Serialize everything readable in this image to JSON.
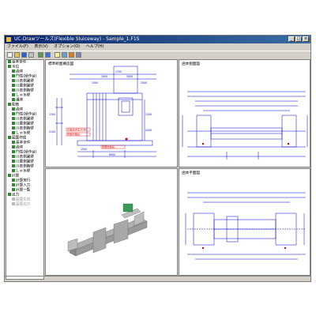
{
  "window": {
    "title": "UC-Drawツールズ(Flexible Sluiceway) - Sample_1.F1S",
    "controls": {
      "minimize": "_",
      "maximize": "□",
      "close": "×"
    }
  },
  "menu": [
    {
      "label": "ファイル(F)"
    },
    {
      "label": "表示(V)"
    },
    {
      "label": "オプション(O)"
    },
    {
      "label": "ヘルプ(H)"
    }
  ],
  "toolbar": {
    "buttons": [
      {
        "icon": "new-file-icon"
      },
      {
        "icon": "open-folder-icon"
      },
      {
        "icon": "save-icon"
      },
      {
        "icon": "print-icon"
      },
      {
        "icon": "layout-icon"
      },
      {
        "icon": "drawing-icon"
      },
      {
        "icon": "help-icon"
      },
      {
        "icon": "view-icon"
      },
      {
        "icon": "zoom-icon"
      },
      {
        "icon": "settings-icon"
      }
    ]
  },
  "tree": [
    {
      "label": "基本条件",
      "level": 0
    },
    {
      "label": "水位",
      "level": 0
    },
    {
      "label": "函体",
      "level": 1
    },
    {
      "label": "門柱(操作台)",
      "level": 1
    },
    {
      "label": "川表側翼壁",
      "level": 1
    },
    {
      "label": "川裏側翼壁",
      "level": 1
    },
    {
      "label": "川表側胸壁",
      "level": 1
    },
    {
      "label": "しゃ水壁",
      "level": 1
    },
    {
      "label": "護床",
      "level": 1
    },
    {
      "label": "配筋",
      "level": 0
    },
    {
      "label": "函体",
      "level": 1
    },
    {
      "label": "門柱(操作台)",
      "level": 1
    },
    {
      "label": "川表側翼壁",
      "level": 1
    },
    {
      "label": "川裏側翼壁",
      "level": 1
    },
    {
      "label": "川表側胸壁",
      "level": 1
    },
    {
      "label": "しゃ水壁",
      "level": 1
    },
    {
      "label": "図面作成",
      "level": 0
    },
    {
      "label": "基本条件",
      "level": 1
    },
    {
      "label": "函体",
      "level": 1
    },
    {
      "label": "門柱(操作台)",
      "level": 1
    },
    {
      "label": "川表側翼壁",
      "level": 1
    },
    {
      "label": "川裏側翼壁",
      "level": 1
    },
    {
      "label": "川表側胸壁",
      "level": 1
    },
    {
      "label": "しゃ水壁",
      "level": 1
    },
    {
      "label": "計算",
      "level": 0
    },
    {
      "label": "計算実行",
      "level": 1
    },
    {
      "label": "計算入力",
      "level": 1
    },
    {
      "label": "計算一覧",
      "level": 1
    },
    {
      "label": "出力",
      "level": 0
    },
    {
      "label": "図面生成",
      "level": 1,
      "disabled": true
    },
    {
      "label": "図面出力",
      "level": 1,
      "disabled": true
    }
  ],
  "panes": {
    "top_left": {
      "title": "標準断面構造図"
    },
    "top_right": {
      "title": "函体側面図"
    },
    "bottom_left": {
      "title": ""
    },
    "bottom_right": {
      "title": "函体平面図"
    }
  },
  "drawing": {
    "dims_top_left": [
      "1700",
      "1000",
      "3500",
      "1500",
      "2500",
      "1300",
      "2100",
      "6500",
      "1200",
      "4200",
      "1500"
    ],
    "red_notes_top_left": [
      "計画高水位 H.W.L",
      "床版天端高",
      "基礎底面高"
    ],
    "colors": {
      "line": "#0000cc",
      "red": "#e00000",
      "shape_gray": "#9a9a9a",
      "green": "#2e8b2e"
    }
  }
}
